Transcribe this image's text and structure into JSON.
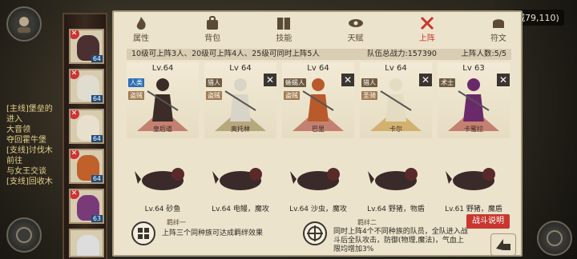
{
  "city": "城79,110)",
  "chat": [
    "[主线]堡垒的",
    "进入",
    "大音领",
    "夺回霍牛堡",
    "[支线]讨伐木",
    "前往",
    "与女王交谈",
    "[支线]回收木"
  ],
  "tabs": [
    {
      "label": "属性",
      "icon": "flame-icon",
      "active": false
    },
    {
      "label": "背包",
      "icon": "bag-icon",
      "active": false
    },
    {
      "label": "技能",
      "icon": "book-icon",
      "active": false
    },
    {
      "label": "天赋",
      "icon": "eye-icon",
      "active": false
    },
    {
      "label": "上阵",
      "icon": "swords-icon",
      "active": true
    },
    {
      "label": "符文",
      "icon": "helmet-icon",
      "active": false
    }
  ],
  "info": {
    "rule": "10级可上阵3人、20级可上阵4人、25级可同时上阵5人",
    "power": "队伍总战力:157390",
    "count": "上阵人数:5/5"
  },
  "heroes": [
    {
      "level": "Lv.64",
      "tags": [
        "人类",
        "盗贼"
      ],
      "name": "皇后道",
      "pet": "Lv.64 砂鱼",
      "removable": false,
      "color": "#3b2c28",
      "ped": "#a5332a"
    },
    {
      "level": "Lv 64",
      "tags": [
        "猎人",
        "盗贼"
      ],
      "name": "奥托林",
      "pet": "Lv.64 电鳗，魔攻",
      "removable": true,
      "color": "#d9d4c8",
      "ped": "#8c7a40"
    },
    {
      "level": "Lv 64",
      "tags": [
        "蜥蜴人",
        "盗贼"
      ],
      "name": "巴里",
      "pet": "Lv.64 沙虫，魔攻",
      "removable": true,
      "color": "#b85a2a",
      "ped": "#a5332a"
    },
    {
      "level": "Lv 64",
      "tags": [
        "猎人",
        "圣骑"
      ],
      "name": "卡尔",
      "pet": "Lv.64 野猪，物盾",
      "removable": true,
      "color": "#e4dcc2",
      "ped": "#c18c2a"
    },
    {
      "level": "Lv 63",
      "tags": [
        "术士"
      ],
      "name": "卡蜜拉",
      "pet": "Lv.61 野猪，魔盾",
      "removable": true,
      "color": "#6a2a6a",
      "ped": "#a5332a"
    }
  ],
  "roster": [
    "64",
    "64",
    "64",
    "64",
    "63",
    ""
  ],
  "bond1": {
    "title": "羁绊一",
    "text": "上阵三个同种族可达成羁绊效果"
  },
  "bond2": {
    "title": "羁绊二",
    "text": "同时上阵4个不同种族的队员，全队进入战斗后全队攻击，防御(物理,魔法)，气血上限均增加3%"
  },
  "fight_label": "战斗说明",
  "colors": {
    "accent": "#c9362e",
    "panel": "#ece3cc",
    "tag_human": "#2d6fb5",
    "tag_rogue": "#a07a50"
  }
}
